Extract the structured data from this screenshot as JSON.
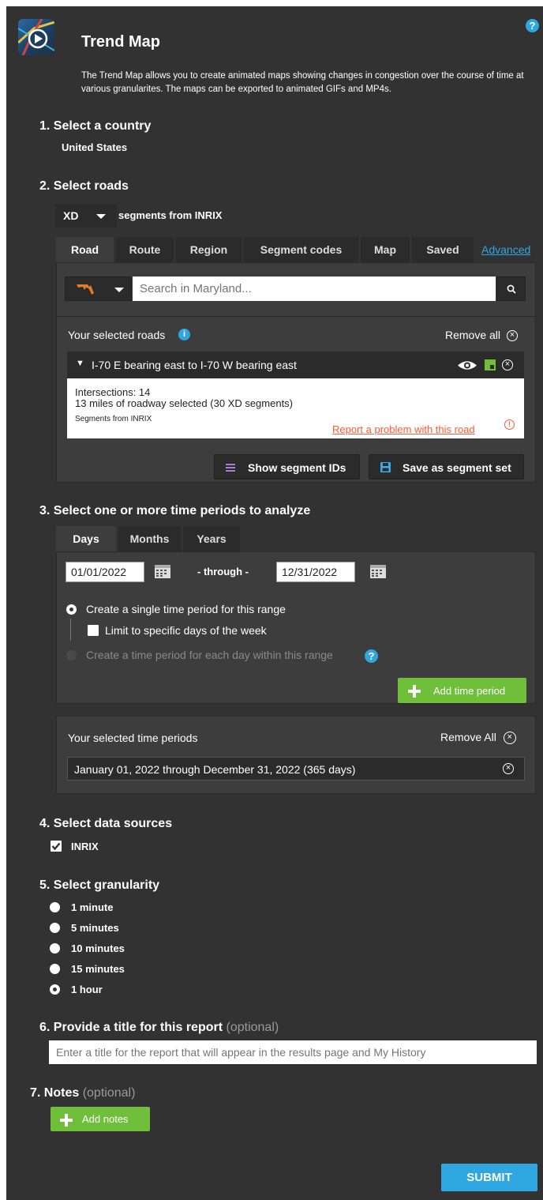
{
  "header": {
    "title": "Trend Map",
    "description": "The Trend Map allows you to create animated maps showing changes in congestion over the course of time at various granularites. The maps can be exported to animated GIFs and MP4s."
  },
  "step1": {
    "title": "1. Select a country",
    "value": "United States"
  },
  "step2": {
    "title": "2. Select roads",
    "segment_type": "XD",
    "segments_from": "segments from INRIX",
    "tabs": [
      "Road",
      "Route",
      "Region",
      "Segment codes",
      "Map",
      "Saved"
    ],
    "advanced_link": "Advanced",
    "search_placeholder": "Search in Maryland...",
    "selected_roads_label": "Your selected roads",
    "remove_all": "Remove all",
    "road": {
      "name": "I-70 E bearing east to I-70 W bearing east",
      "intersections": "Intersections: 14",
      "miles": "13 miles of roadway selected (30 XD segments)",
      "source": "Segments from INRIX",
      "report_link": "Report a problem with this road"
    },
    "show_segment_ids": "Show segment IDs",
    "save_segment_set": "Save as segment set"
  },
  "step3": {
    "title": "3. Select one or more time periods to analyze",
    "tabs": [
      "Days",
      "Months",
      "Years"
    ],
    "start_date": "01/01/2022",
    "through": "- through -",
    "end_date": "12/31/2022",
    "opt_single": "Create a single time period for this range",
    "opt_limit": "Limit to specific days of the week",
    "opt_each": "Create a time period for each day within this range",
    "add_time_period": "Add time period",
    "selected_periods_label": "Your selected time periods",
    "remove_all": "Remove All",
    "period": "January 01, 2022 through December 31, 2022 (365 days)"
  },
  "step4": {
    "title": "4. Select data sources",
    "source": "INRIX"
  },
  "step5": {
    "title": "5. Select granularity",
    "options": [
      "1 minute",
      "5 minutes",
      "10 minutes",
      "15 minutes",
      "1 hour"
    ],
    "selected": "1 hour"
  },
  "step6": {
    "title": "6. Provide a title for this report",
    "optional": "(optional)",
    "placeholder": "Enter a title for the report that will appear in the results page and My History"
  },
  "step7": {
    "title": "7. Notes",
    "optional": "(optional)",
    "add_notes": "Add notes"
  },
  "submit": "SUBMIT",
  "colors": {
    "background": "#323232",
    "panel": "#3d3d3d",
    "accent_blue": "#2ea7e0",
    "green": "#6fbf3a",
    "link_red": "#ff5a36"
  },
  "icons": [
    "logo-icon",
    "help-icon",
    "info-icon",
    "maryland-state-icon",
    "search-icon",
    "eye-icon",
    "color-swatch-icon",
    "close-icon",
    "list-icon",
    "save-icon",
    "calendar-icon",
    "warning-icon",
    "plus-icon",
    "check-icon"
  ]
}
